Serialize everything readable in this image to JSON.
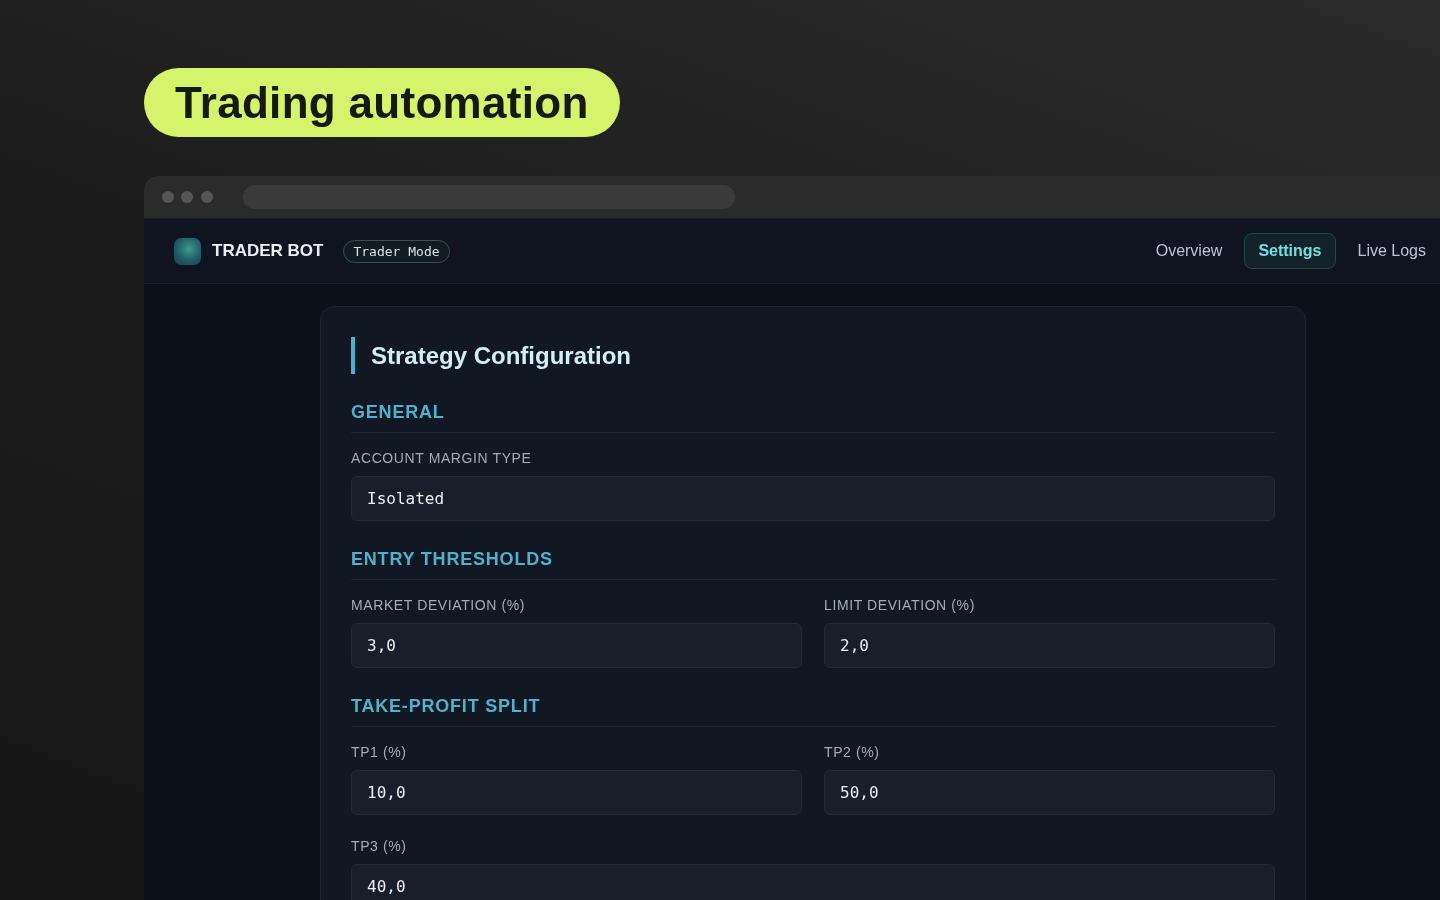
{
  "headline": "Trading automation",
  "app": {
    "brand": "TRADER BOT",
    "mode_badge": "Trader Mode",
    "nav": [
      {
        "label": "Overview",
        "selected": false
      },
      {
        "label": "Settings",
        "selected": true
      },
      {
        "label": "Live Logs",
        "selected": false
      }
    ]
  },
  "config": {
    "title": "Strategy Configuration",
    "sections": [
      {
        "title": "GENERAL",
        "rows": [
          {
            "fields": [
              {
                "label": "ACCOUNT MARGIN TYPE",
                "value": "Isolated"
              }
            ]
          }
        ]
      },
      {
        "title": "ENTRY THRESHOLDS",
        "rows": [
          {
            "fields": [
              {
                "label": "MARKET DEVIATION (%)",
                "value": "3,0"
              },
              {
                "label": "LIMIT DEVIATION (%)",
                "value": "2,0"
              }
            ]
          }
        ]
      },
      {
        "title": "TAKE-PROFIT SPLIT",
        "rows": [
          {
            "fields": [
              {
                "label": "TP1 (%)",
                "value": "10,0"
              },
              {
                "label": "TP2 (%)",
                "value": "50,0"
              }
            ]
          },
          {
            "fields": [
              {
                "label": "TP3 (%)",
                "value": "40,0"
              }
            ]
          }
        ]
      }
    ]
  }
}
